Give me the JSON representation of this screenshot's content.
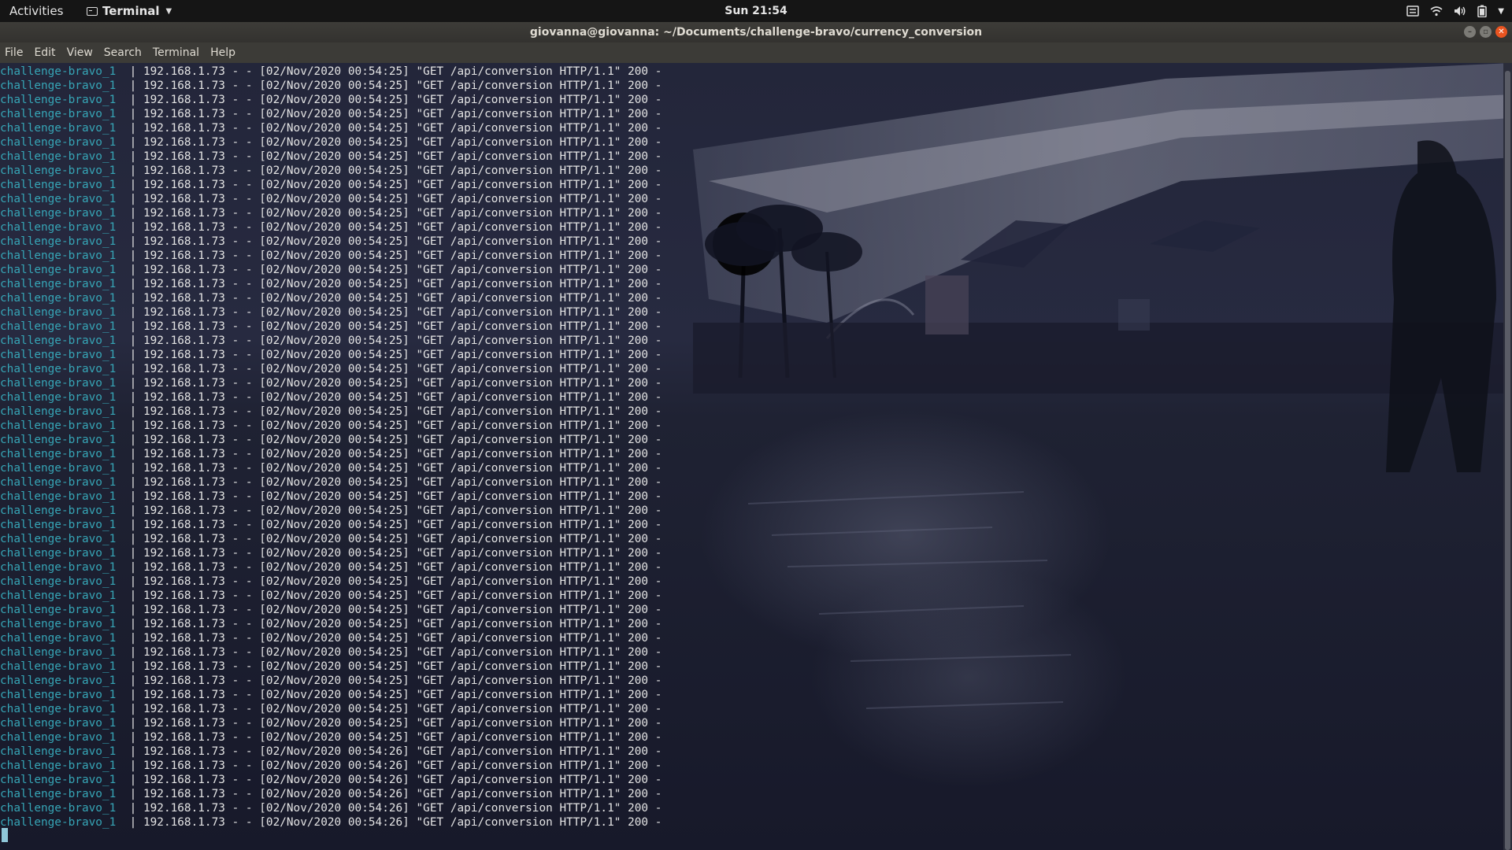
{
  "topbar": {
    "activities": "Activities",
    "app_name": "Terminal",
    "clock": "Sun 21:54",
    "tray_icons": [
      "menu-icon",
      "wifi-icon",
      "volume-icon",
      "battery-icon",
      "chevron-down-icon"
    ]
  },
  "window": {
    "title": "giovanna@giovanna: ~/Documents/challenge-bravo/currency_conversion",
    "controls": [
      "minimize",
      "maximize",
      "close"
    ]
  },
  "menubar": {
    "items": [
      "File",
      "Edit",
      "View",
      "Search",
      "Terminal",
      "Help"
    ]
  },
  "terminal": {
    "service": "challenge-bravo_1",
    "separator": "|",
    "lines": [
      "192.168.1.73 - - [02/Nov/2020 00:54:25] \"GET /api/conversion HTTP/1.1\" 200 -",
      "192.168.1.73 - - [02/Nov/2020 00:54:25] \"GET /api/conversion HTTP/1.1\" 200 -",
      "192.168.1.73 - - [02/Nov/2020 00:54:25] \"GET /api/conversion HTTP/1.1\" 200 -",
      "192.168.1.73 - - [02/Nov/2020 00:54:25] \"GET /api/conversion HTTP/1.1\" 200 -",
      "192.168.1.73 - - [02/Nov/2020 00:54:25] \"GET /api/conversion HTTP/1.1\" 200 -",
      "192.168.1.73 - - [02/Nov/2020 00:54:25] \"GET /api/conversion HTTP/1.1\" 200 -",
      "192.168.1.73 - - [02/Nov/2020 00:54:25] \"GET /api/conversion HTTP/1.1\" 200 -",
      "192.168.1.73 - - [02/Nov/2020 00:54:25] \"GET /api/conversion HTTP/1.1\" 200 -",
      "192.168.1.73 - - [02/Nov/2020 00:54:25] \"GET /api/conversion HTTP/1.1\" 200 -",
      "192.168.1.73 - - [02/Nov/2020 00:54:25] \"GET /api/conversion HTTP/1.1\" 200 -",
      "192.168.1.73 - - [02/Nov/2020 00:54:25] \"GET /api/conversion HTTP/1.1\" 200 -",
      "192.168.1.73 - - [02/Nov/2020 00:54:25] \"GET /api/conversion HTTP/1.1\" 200 -",
      "192.168.1.73 - - [02/Nov/2020 00:54:25] \"GET /api/conversion HTTP/1.1\" 200 -",
      "192.168.1.73 - - [02/Nov/2020 00:54:25] \"GET /api/conversion HTTP/1.1\" 200 -",
      "192.168.1.73 - - [02/Nov/2020 00:54:25] \"GET /api/conversion HTTP/1.1\" 200 -",
      "192.168.1.73 - - [02/Nov/2020 00:54:25] \"GET /api/conversion HTTP/1.1\" 200 -",
      "192.168.1.73 - - [02/Nov/2020 00:54:25] \"GET /api/conversion HTTP/1.1\" 200 -",
      "192.168.1.73 - - [02/Nov/2020 00:54:25] \"GET /api/conversion HTTP/1.1\" 200 -",
      "192.168.1.73 - - [02/Nov/2020 00:54:25] \"GET /api/conversion HTTP/1.1\" 200 -",
      "192.168.1.73 - - [02/Nov/2020 00:54:25] \"GET /api/conversion HTTP/1.1\" 200 -",
      "192.168.1.73 - - [02/Nov/2020 00:54:25] \"GET /api/conversion HTTP/1.1\" 200 -",
      "192.168.1.73 - - [02/Nov/2020 00:54:25] \"GET /api/conversion HTTP/1.1\" 200 -",
      "192.168.1.73 - - [02/Nov/2020 00:54:25] \"GET /api/conversion HTTP/1.1\" 200 -",
      "192.168.1.73 - - [02/Nov/2020 00:54:25] \"GET /api/conversion HTTP/1.1\" 200 -",
      "192.168.1.73 - - [02/Nov/2020 00:54:25] \"GET /api/conversion HTTP/1.1\" 200 -",
      "192.168.1.73 - - [02/Nov/2020 00:54:25] \"GET /api/conversion HTTP/1.1\" 200 -",
      "192.168.1.73 - - [02/Nov/2020 00:54:25] \"GET /api/conversion HTTP/1.1\" 200 -",
      "192.168.1.73 - - [02/Nov/2020 00:54:25] \"GET /api/conversion HTTP/1.1\" 200 -",
      "192.168.1.73 - - [02/Nov/2020 00:54:25] \"GET /api/conversion HTTP/1.1\" 200 -",
      "192.168.1.73 - - [02/Nov/2020 00:54:25] \"GET /api/conversion HTTP/1.1\" 200 -",
      "192.168.1.73 - - [02/Nov/2020 00:54:25] \"GET /api/conversion HTTP/1.1\" 200 -",
      "192.168.1.73 - - [02/Nov/2020 00:54:25] \"GET /api/conversion HTTP/1.1\" 200 -",
      "192.168.1.73 - - [02/Nov/2020 00:54:25] \"GET /api/conversion HTTP/1.1\" 200 -",
      "192.168.1.73 - - [02/Nov/2020 00:54:25] \"GET /api/conversion HTTP/1.1\" 200 -",
      "192.168.1.73 - - [02/Nov/2020 00:54:25] \"GET /api/conversion HTTP/1.1\" 200 -",
      "192.168.1.73 - - [02/Nov/2020 00:54:25] \"GET /api/conversion HTTP/1.1\" 200 -",
      "192.168.1.73 - - [02/Nov/2020 00:54:25] \"GET /api/conversion HTTP/1.1\" 200 -",
      "192.168.1.73 - - [02/Nov/2020 00:54:25] \"GET /api/conversion HTTP/1.1\" 200 -",
      "192.168.1.73 - - [02/Nov/2020 00:54:25] \"GET /api/conversion HTTP/1.1\" 200 -",
      "192.168.1.73 - - [02/Nov/2020 00:54:25] \"GET /api/conversion HTTP/1.1\" 200 -",
      "192.168.1.73 - - [02/Nov/2020 00:54:25] \"GET /api/conversion HTTP/1.1\" 200 -",
      "192.168.1.73 - - [02/Nov/2020 00:54:25] \"GET /api/conversion HTTP/1.1\" 200 -",
      "192.168.1.73 - - [02/Nov/2020 00:54:25] \"GET /api/conversion HTTP/1.1\" 200 -",
      "192.168.1.73 - - [02/Nov/2020 00:54:25] \"GET /api/conversion HTTP/1.1\" 200 -",
      "192.168.1.73 - - [02/Nov/2020 00:54:25] \"GET /api/conversion HTTP/1.1\" 200 -",
      "192.168.1.73 - - [02/Nov/2020 00:54:25] \"GET /api/conversion HTTP/1.1\" 200 -",
      "192.168.1.73 - - [02/Nov/2020 00:54:25] \"GET /api/conversion HTTP/1.1\" 200 -",
      "192.168.1.73 - - [02/Nov/2020 00:54:25] \"GET /api/conversion HTTP/1.1\" 200 -",
      "192.168.1.73 - - [02/Nov/2020 00:54:26] \"GET /api/conversion HTTP/1.1\" 200 -",
      "192.168.1.73 - - [02/Nov/2020 00:54:26] \"GET /api/conversion HTTP/1.1\" 200 -",
      "192.168.1.73 - - [02/Nov/2020 00:54:26] \"GET /api/conversion HTTP/1.1\" 200 -",
      "192.168.1.73 - - [02/Nov/2020 00:54:26] \"GET /api/conversion HTTP/1.1\" 200 -",
      "192.168.1.73 - - [02/Nov/2020 00:54:26] \"GET /api/conversion HTTP/1.1\" 200 -",
      "192.168.1.73 - - [02/Nov/2020 00:54:26] \"GET /api/conversion HTTP/1.1\" 200 -"
    ]
  },
  "colors": {
    "service_name": "#36a5b6",
    "log_text": "#e4e4e4",
    "ubuntu_orange": "#e95420",
    "terminal_bg": "#1c1f30"
  }
}
